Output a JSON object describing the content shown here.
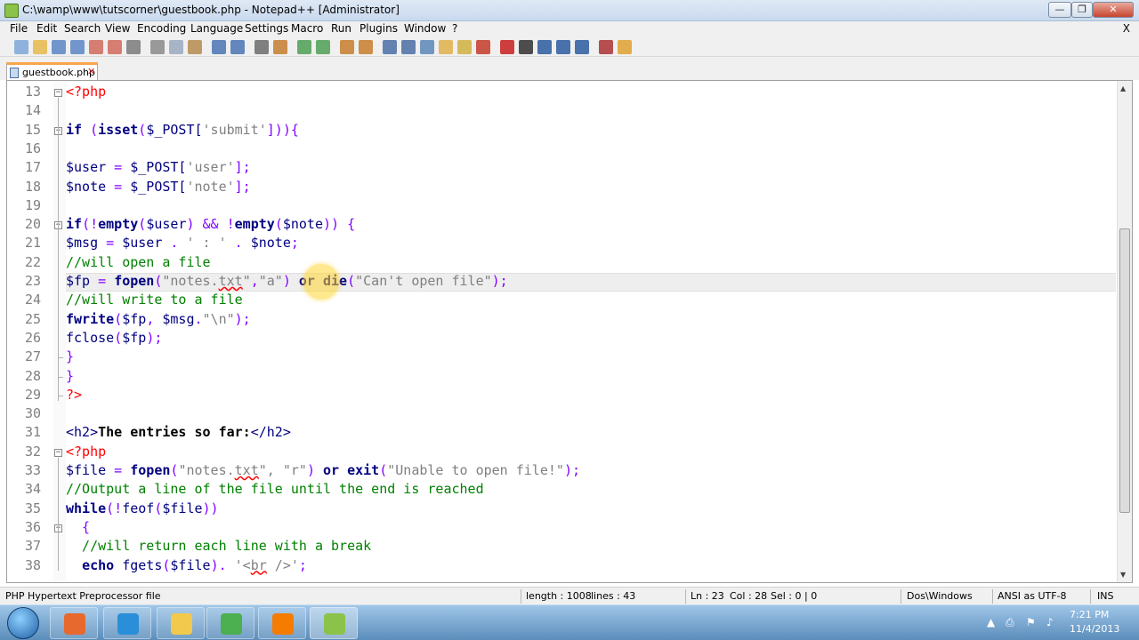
{
  "window": {
    "title": "C:\\wamp\\www\\tutscorner\\guestbook.php - Notepad++ [Administrator]",
    "min_label": "—",
    "max_label": "❐",
    "close_label": "✕"
  },
  "menu": {
    "items": [
      "File",
      "Edit",
      "Search",
      "View",
      "Encoding",
      "Language",
      "Settings",
      "Macro",
      "Run",
      "Plugins",
      "Window",
      "?"
    ],
    "close_x": "X"
  },
  "toolbar": {
    "icons": [
      "new-file-icon",
      "open-file-icon",
      "save-icon",
      "save-all-icon",
      "close-icon",
      "close-all-icon",
      "print-icon",
      "cut-icon",
      "copy-icon",
      "paste-icon",
      "undo-icon",
      "redo-icon",
      "find-icon",
      "replace-icon",
      "zoom-in-icon",
      "zoom-out-icon",
      "sync-v-icon",
      "sync-h-icon",
      "wrap-icon",
      "all-chars-icon",
      "indent-guide-icon",
      "folder-as-workspace-icon",
      "document-map-icon",
      "function-list-icon",
      "record-macro-icon",
      "stop-macro-icon",
      "play-macro-icon",
      "run-macro-multiple-icon",
      "save-macro-icon",
      "spellcheck-icon",
      "lang-icon"
    ]
  },
  "tab": {
    "label": "guestbook.php",
    "close": "✕"
  },
  "editor": {
    "lines": [
      {
        "num": "13",
        "fold": "−",
        "tokens": [
          {
            "t": "<?php",
            "c": "tag"
          }
        ]
      },
      {
        "num": "14",
        "tokens": []
      },
      {
        "num": "15",
        "fold": "−",
        "tokens": [
          {
            "t": "if",
            "c": "kw"
          },
          {
            "t": " (",
            "c": "op"
          },
          {
            "t": "isset",
            "c": "kw"
          },
          {
            "t": "(",
            "c": "op"
          },
          {
            "t": "$_POST[",
            "c": "var"
          },
          {
            "t": "'submit'",
            "c": "str"
          },
          {
            "t": "])){",
            "c": "op"
          }
        ]
      },
      {
        "num": "16",
        "tokens": []
      },
      {
        "num": "17",
        "tokens": [
          {
            "t": "$user",
            "c": "var"
          },
          {
            "t": " = ",
            "c": "op"
          },
          {
            "t": "$_POST[",
            "c": "var"
          },
          {
            "t": "'user'",
            "c": "str"
          },
          {
            "t": "];",
            "c": "op"
          }
        ]
      },
      {
        "num": "18",
        "tokens": [
          {
            "t": "$note",
            "c": "var"
          },
          {
            "t": " = ",
            "c": "op"
          },
          {
            "t": "$_POST[",
            "c": "var"
          },
          {
            "t": "'note'",
            "c": "str"
          },
          {
            "t": "];",
            "c": "op"
          }
        ]
      },
      {
        "num": "19",
        "tokens": []
      },
      {
        "num": "20",
        "fold": "−",
        "tokens": [
          {
            "t": "if",
            "c": "kw"
          },
          {
            "t": "(!",
            "c": "op"
          },
          {
            "t": "empty",
            "c": "kw"
          },
          {
            "t": "(",
            "c": "op"
          },
          {
            "t": "$user",
            "c": "var"
          },
          {
            "t": ") && !",
            "c": "op"
          },
          {
            "t": "empty",
            "c": "kw"
          },
          {
            "t": "(",
            "c": "op"
          },
          {
            "t": "$note",
            "c": "var"
          },
          {
            "t": ")) {",
            "c": "op"
          }
        ]
      },
      {
        "num": "21",
        "tokens": [
          {
            "t": "$msg",
            "c": "var"
          },
          {
            "t": " = ",
            "c": "op"
          },
          {
            "t": "$user",
            "c": "var"
          },
          {
            "t": " . ",
            "c": "op"
          },
          {
            "t": "' : '",
            "c": "str"
          },
          {
            "t": " . ",
            "c": "op"
          },
          {
            "t": "$note",
            "c": "var"
          },
          {
            "t": ";",
            "c": "op"
          }
        ]
      },
      {
        "num": "22",
        "tokens": [
          {
            "t": "//will open a file",
            "c": "cmt"
          }
        ]
      },
      {
        "num": "23",
        "tokens": [
          {
            "t": "$fp",
            "c": "var"
          },
          {
            "t": " = ",
            "c": "op"
          },
          {
            "t": "fopen",
            "c": "kw"
          },
          {
            "t": "(",
            "c": "op"
          },
          {
            "t": "\"notes.",
            "c": "str"
          },
          {
            "t": "txt",
            "c": "str-squig"
          },
          {
            "t": "\"",
            "c": "str"
          },
          {
            "t": ",",
            "c": "op"
          },
          {
            "t": "\"a\"",
            "c": "str"
          },
          {
            "t": ") ",
            "c": "op"
          },
          {
            "t": "or",
            "c": "kw"
          },
          {
            "t": " ",
            "c": "plain"
          },
          {
            "t": "die",
            "c": "kw"
          },
          {
            "t": "(",
            "c": "op"
          },
          {
            "t": "\"Can't open file\"",
            "c": "str"
          },
          {
            "t": ");",
            "c": "op"
          }
        ]
      },
      {
        "num": "24",
        "tokens": [
          {
            "t": "//will write to a file",
            "c": "cmt"
          }
        ]
      },
      {
        "num": "25",
        "tokens": [
          {
            "t": "fwrite",
            "c": "kw"
          },
          {
            "t": "(",
            "c": "op"
          },
          {
            "t": "$fp",
            "c": "var"
          },
          {
            "t": ", ",
            "c": "op"
          },
          {
            "t": "$msg",
            "c": "var"
          },
          {
            "t": ".",
            "c": "op"
          },
          {
            "t": "\"\\n\"",
            "c": "str"
          },
          {
            "t": ");",
            "c": "op"
          }
        ]
      },
      {
        "num": "26",
        "tokens": [
          {
            "t": "fclose",
            "c": "fn"
          },
          {
            "t": "(",
            "c": "op"
          },
          {
            "t": "$fp",
            "c": "var"
          },
          {
            "t": ");",
            "c": "op"
          }
        ]
      },
      {
        "num": "27",
        "foldend": true,
        "tokens": [
          {
            "t": "}",
            "c": "op"
          }
        ]
      },
      {
        "num": "28",
        "foldend": true,
        "tokens": [
          {
            "t": "}",
            "c": "op"
          }
        ]
      },
      {
        "num": "29",
        "foldend": true,
        "tokens": [
          {
            "t": "?>",
            "c": "tag"
          }
        ]
      },
      {
        "num": "30",
        "tokens": []
      },
      {
        "num": "31",
        "tokens": [
          {
            "t": "<h2>",
            "c": "def"
          },
          {
            "t": "The entries so far:",
            "c": "bold"
          },
          {
            "t": "</h2>",
            "c": "def"
          }
        ]
      },
      {
        "num": "32",
        "fold": "−",
        "tokens": [
          {
            "t": "<?php",
            "c": "tag"
          }
        ]
      },
      {
        "num": "33",
        "tokens": [
          {
            "t": "$file",
            "c": "var"
          },
          {
            "t": " = ",
            "c": "op"
          },
          {
            "t": "fopen",
            "c": "kw"
          },
          {
            "t": "(",
            "c": "op"
          },
          {
            "t": "\"notes.",
            "c": "str"
          },
          {
            "t": "txt",
            "c": "str-squig"
          },
          {
            "t": "\", \"r\"",
            "c": "str"
          },
          {
            "t": ") ",
            "c": "op"
          },
          {
            "t": "or",
            "c": "kw"
          },
          {
            "t": " ",
            "c": "plain"
          },
          {
            "t": "exit",
            "c": "kw"
          },
          {
            "t": "(",
            "c": "op"
          },
          {
            "t": "\"Unable to open file!\"",
            "c": "str"
          },
          {
            "t": ");",
            "c": "op"
          }
        ]
      },
      {
        "num": "34",
        "tokens": [
          {
            "t": "//Output a line of the file until the end is reached",
            "c": "cmt"
          }
        ]
      },
      {
        "num": "35",
        "tokens": [
          {
            "t": "while",
            "c": "kw"
          },
          {
            "t": "(!",
            "c": "op"
          },
          {
            "t": "feof",
            "c": "fn"
          },
          {
            "t": "(",
            "c": "op"
          },
          {
            "t": "$file",
            "c": "var"
          },
          {
            "t": "))",
            "c": "op"
          }
        ]
      },
      {
        "num": "36",
        "fold": "−",
        "tokens": [
          {
            "t": "  {",
            "c": "op"
          }
        ]
      },
      {
        "num": "37",
        "tokens": [
          {
            "t": "  //will return each line with a break",
            "c": "cmt"
          }
        ]
      },
      {
        "num": "38",
        "tokens": [
          {
            "t": "  ",
            "c": "plain"
          },
          {
            "t": "echo",
            "c": "kw"
          },
          {
            "t": " ",
            "c": "plain"
          },
          {
            "t": "fgets",
            "c": "fn"
          },
          {
            "t": "(",
            "c": "op"
          },
          {
            "t": "$file",
            "c": "var"
          },
          {
            "t": "). ",
            "c": "op"
          },
          {
            "t": "'<",
            "c": "str"
          },
          {
            "t": "br",
            "c": "str-squig"
          },
          {
            "t": " />'",
            "c": "str"
          },
          {
            "t": ";",
            "c": "op"
          }
        ]
      }
    ]
  },
  "status": {
    "file_type": "PHP Hypertext Preprocessor file",
    "length": "length : 1008",
    "lines": "lines : 43",
    "ln": "Ln : 23",
    "col": "Col : 28",
    "sel": "Sel : 0 | 0",
    "eol": "Dos\\Windows",
    "encoding": "ANSI as UTF-8",
    "ins": "INS"
  },
  "taskbar": {
    "apps": [
      {
        "name": "media-player-app",
        "color": "#e8692e"
      },
      {
        "name": "internet-explorer-app",
        "color": "#2a8fd8"
      },
      {
        "name": "explorer-app",
        "color": "#f2c94c"
      },
      {
        "name": "chrome-app",
        "color": "#4caf50"
      },
      {
        "name": "firefox-app",
        "color": "#f57c00"
      },
      {
        "name": "notepadpp-app",
        "color": "#8bc34a"
      }
    ],
    "time": "7:21 PM",
    "date": "11/4/2013"
  }
}
